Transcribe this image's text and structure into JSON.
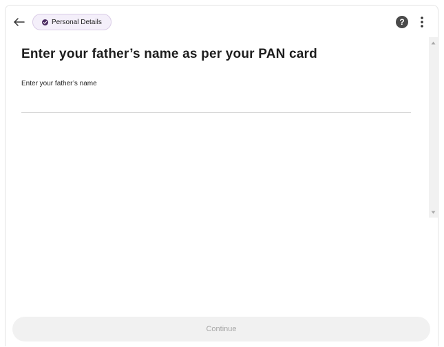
{
  "header": {
    "step_badge": "Personal Details"
  },
  "form": {
    "title": "Enter your father’s name as per your PAN card",
    "field_label": "Enter your father’s name",
    "field_value": ""
  },
  "footer": {
    "continue_label": "Continue"
  },
  "icons": {
    "back": "arrow-left-icon",
    "badge": "check-circle-icon",
    "help": "help-icon",
    "more": "more-vertical-icon"
  },
  "colors": {
    "badge_background": "#f4effa",
    "badge_border": "#d9cbe6",
    "badge_check": "#4b2a61",
    "help_circle": "#4a4a4a",
    "disabled_button": "#f1f1f1",
    "disabled_text": "#a6a6a6"
  }
}
